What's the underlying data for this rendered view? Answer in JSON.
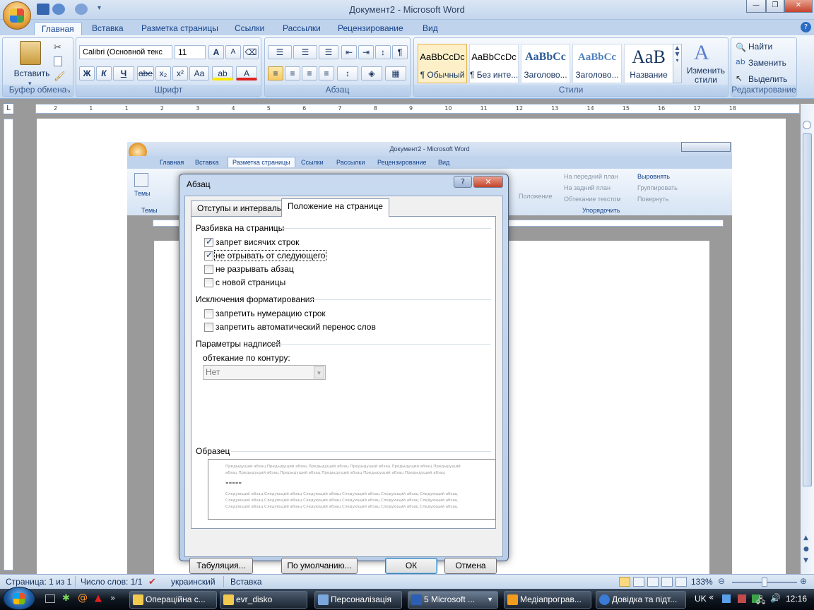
{
  "window": {
    "title": "Документ2 - Microsoft Word",
    "minimize": "—",
    "maximize": "❐",
    "close": "✕"
  },
  "tabs": [
    "Главная",
    "Вставка",
    "Разметка страницы",
    "Ссылки",
    "Рассылки",
    "Рецензирование",
    "Вид"
  ],
  "ribbon": {
    "clipboard": {
      "label": "Буфер обмена",
      "paste": "Вставить"
    },
    "font": {
      "label": "Шрифт",
      "name": "Calibri (Основной текс",
      "size": "11",
      "grow": "A",
      "shrink": "A",
      "bold": "Ж",
      "italic": "К",
      "underline": "Ч",
      "strike": "abe",
      "subscript": "x₂",
      "superscript": "x²",
      "case": "Aa"
    },
    "paragraph": {
      "label": "Абзац",
      "pilcrow": "¶"
    },
    "styles": {
      "label": "Стили",
      "items": [
        {
          "sample": "AaBbCcDc",
          "name": "¶ Обычный"
        },
        {
          "sample": "AaBbCcDc",
          "name": "¶ Без инте..."
        },
        {
          "sample": "AaBbCc",
          "name": "Заголово..."
        },
        {
          "sample": "AaBbCc",
          "name": "Заголово..."
        },
        {
          "sample": "AaB",
          "name": "Название"
        }
      ],
      "change": "Изменить",
      "change2": "стили"
    },
    "editing": {
      "label": "Редактирование",
      "find": "Найти",
      "replace": "Заменить",
      "select": "Выделить"
    }
  },
  "ruler": {
    "marks": [
      "2",
      "1",
      "1",
      "2",
      "3",
      "4",
      "5",
      "6",
      "7",
      "8",
      "9",
      "10",
      "11",
      "12",
      "13",
      "14",
      "15",
      "16",
      "17",
      "18"
    ]
  },
  "inner": {
    "title": "Документ2 - Microsoft Word",
    "tabs": [
      "Главная",
      "Вставка",
      "Разметка страницы",
      "Ссылки",
      "Рассылки",
      "Рецензирование",
      "Вид"
    ],
    "themes": "Темы",
    "themes_group": "Темы",
    "front": "На передний план",
    "back": "На задний план",
    "wrap": "Обтекание текстом",
    "align": "Выровнять",
    "group": "Группировать",
    "rotate": "Повернуть",
    "position": "Положение",
    "arrange": "Упорядочить",
    "zoom": "133%"
  },
  "dialog": {
    "title": "Абзац",
    "help": "?",
    "close": "✕",
    "tabs": [
      "Отступы и интервалы",
      "Положение на странице"
    ],
    "pagination": {
      "header": "Разбивка на страницы",
      "options": [
        {
          "label": "запрет висячих строк",
          "checked": true
        },
        {
          "label": "не отрывать от следующего",
          "checked": true
        },
        {
          "label": "не разрывать абзац",
          "checked": false
        },
        {
          "label": "с новой страницы",
          "checked": false
        }
      ]
    },
    "exceptions": {
      "header": "Исключения форматирования",
      "options": [
        {
          "label": "запретить нумерацию строк",
          "checked": false
        },
        {
          "label": "запретить автоматический перенос слов",
          "checked": false
        }
      ]
    },
    "textbox": {
      "header": "Параметры надписей",
      "wrap_label": "обтекание по контуру:",
      "wrap_value": "Нет"
    },
    "preview": {
      "header": "Образец",
      "prev1": "Предыдущий абзац Предыдущий абзац Предыдущий абзац Предыдущий абзац Предыдущий абзац Предыдущий",
      "prev2": "абзац Предыдущий абзац Предыдущий абзац Предыдущий абзац Предыдущий абзац Предыдущий абзац",
      "cur": "=====",
      "next1": "Следующий абзац Следующий абзац Следующий абзац Следующий абзац Следующий абзац Следующий абзац",
      "next2": "Следующий абзац Следующий абзац Следующий абзац Следующий абзац Следующий абзац Следующий абзац",
      "next3": "Следующий абзац Следующий абзац Следующий абзац Следующий абзац Следующий абзац Следующий абзац"
    },
    "buttons": {
      "tabs": "Табуляция...",
      "default": "По умолчанию...",
      "ok": "ОК",
      "cancel": "Отмена"
    }
  },
  "status": {
    "page": "Страница: 1 из 1",
    "words": "Число слов: 1/1",
    "lang": "украинский",
    "mode": "Вставка",
    "zoom": "133%"
  },
  "taskbar": {
    "items": [
      "Операційна с...",
      "evr_disko",
      "Персоналізація",
      "5 Microsoft ...",
      "Медіапрограв...",
      "Довідка та підт..."
    ],
    "lang": "UK",
    "time": "12:16"
  }
}
